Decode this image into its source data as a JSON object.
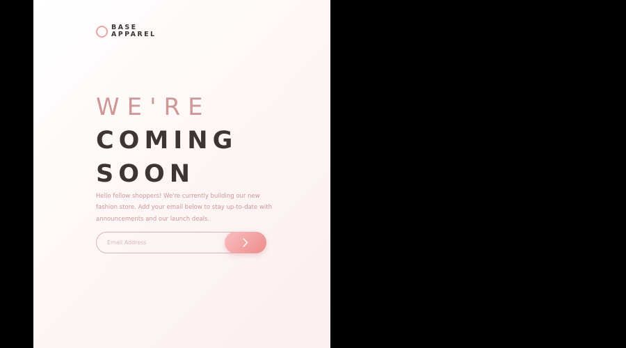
{
  "logo": {
    "line1": "BASE",
    "line2": "APPAREL"
  },
  "headline": {
    "line1": "WE'RE",
    "line2": "COMING",
    "line3": "SOON"
  },
  "description": "Hello fellow shoppers! We're currently building our new fashion store. Add your email below to stay up-to-date with announcements and our launch deals.",
  "form": {
    "email_placeholder": "Email Address",
    "email_value": "",
    "submit_icon": "chevron-right-icon"
  },
  "colors": {
    "accent": "#ce9797",
    "dark_text": "#3d3434",
    "button_gradient_start": "#f8bfbf",
    "button_gradient_end": "#ee8b8b",
    "background_outside": "#000000"
  }
}
